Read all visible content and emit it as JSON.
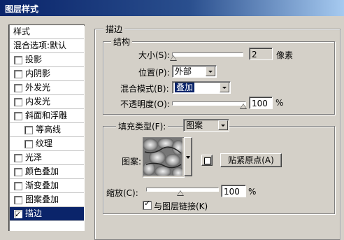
{
  "window": {
    "title": "图层样式"
  },
  "sidebar": {
    "header": "样式",
    "blend_options": "混合选项:默认",
    "items": [
      {
        "label": "投影",
        "checked": false,
        "indent": false
      },
      {
        "label": "内阴影",
        "checked": false,
        "indent": false
      },
      {
        "label": "外发光",
        "checked": false,
        "indent": false
      },
      {
        "label": "内发光",
        "checked": false,
        "indent": false
      },
      {
        "label": "斜面和浮雕",
        "checked": false,
        "indent": false
      },
      {
        "label": "等高线",
        "checked": false,
        "indent": true
      },
      {
        "label": "纹理",
        "checked": false,
        "indent": true
      },
      {
        "label": "光泽",
        "checked": false,
        "indent": false
      },
      {
        "label": "颜色叠加",
        "checked": false,
        "indent": false
      },
      {
        "label": "渐变叠加",
        "checked": false,
        "indent": false
      },
      {
        "label": "图案叠加",
        "checked": false,
        "indent": false
      },
      {
        "label": "描边",
        "checked": true,
        "indent": false,
        "selected": true
      }
    ]
  },
  "stroke": {
    "group_title": "描边",
    "structure": {
      "title": "结构",
      "size_label": "大小(S):",
      "size_value": "2",
      "size_unit": "像素",
      "position_label": "位置(P):",
      "position_value": "外部",
      "blend_label": "混合模式(B):",
      "blend_value": "叠加",
      "opacity_label": "不透明度(O):",
      "opacity_value": "100",
      "opacity_unit": "%"
    },
    "fill": {
      "type_label": "填充类型(F):",
      "type_value": "图案",
      "pattern_label": "图案:",
      "snap_button": "贴紧原点(A)",
      "scale_label": "缩放(C):",
      "scale_value": "100",
      "scale_unit": "%",
      "link_label": "与图层链接(K)",
      "link_checked": true
    }
  }
}
